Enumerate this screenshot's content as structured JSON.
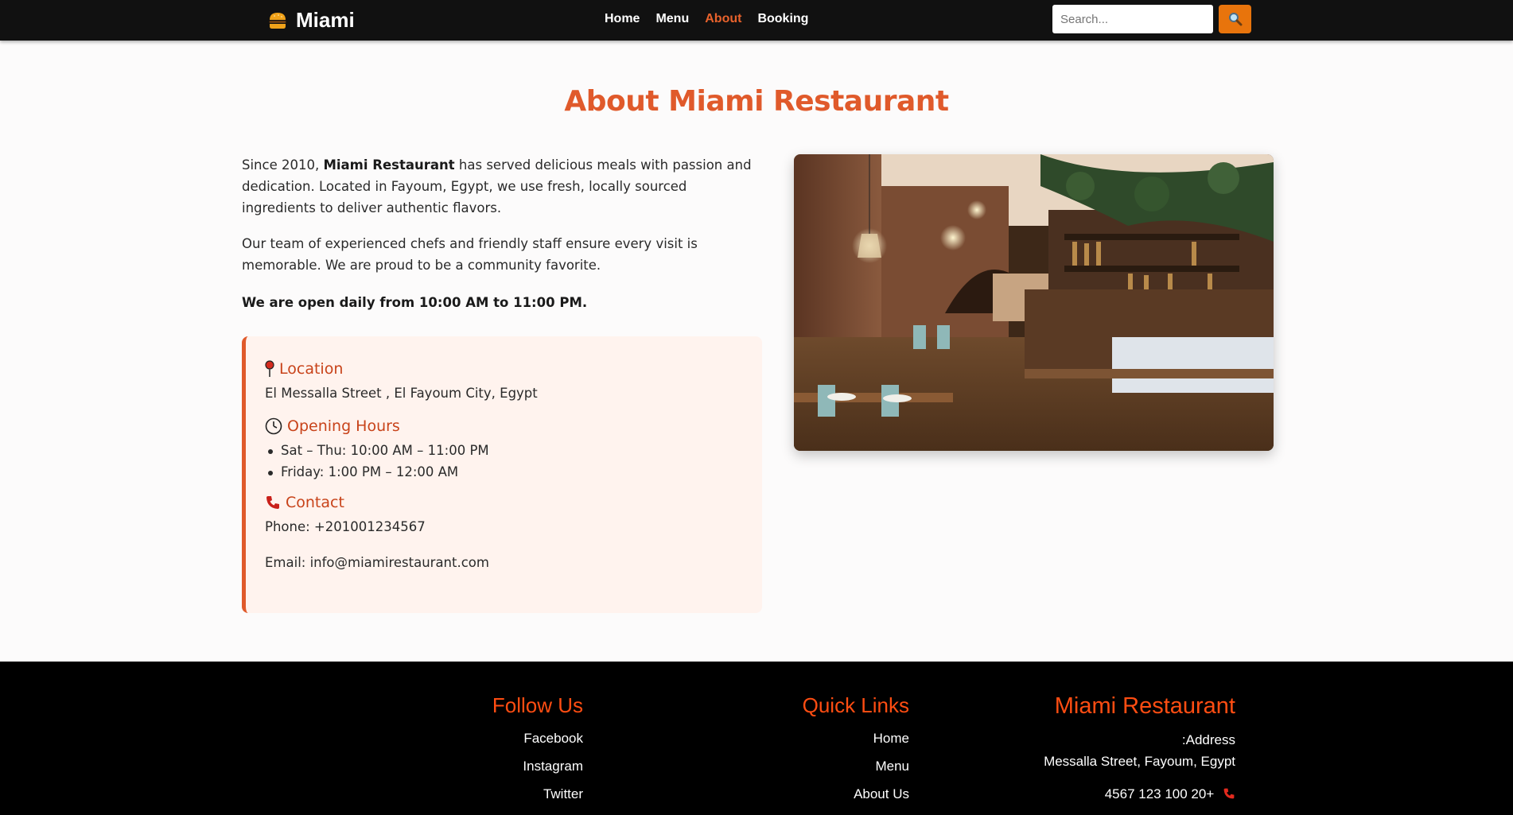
{
  "nav": {
    "brand": "Miami",
    "links": [
      "Home",
      "Menu",
      "About",
      "Booking"
    ],
    "active": "About",
    "search_placeholder": "Search..."
  },
  "about": {
    "title": "About Miami Restaurant",
    "p1_before": "Since 2010, ",
    "p1_bold": "Miami Restaurant",
    "p1_after": " has served delicious meals with passion and dedication. Located in Fayoum, Egypt, we use fresh, locally sourced ingredients to deliver authentic flavors.",
    "p2": "Our team of experienced chefs and friendly staff ensure every visit is memorable. We are proud to be a community favorite.",
    "p3": "We are open daily from 10:00 AM to 11:00 PM."
  },
  "info": {
    "location_heading": "Location",
    "location_text": "El Messalla Street , El Fayoum City, Egypt",
    "hours_heading": "Opening Hours",
    "hours": [
      "Sat – Thu: 10:00 AM – 11:00 PM",
      "Friday: 1:00 PM – 12:00 AM"
    ],
    "contact_heading": "Contact",
    "phone": "Phone: +201001234567",
    "email": "Email: info@miamirestaurant.com"
  },
  "footer": {
    "follow_heading": "Follow Us",
    "follow_links": [
      "Facebook",
      "Instagram",
      "Twitter"
    ],
    "quick_heading": "Quick Links",
    "quick_links": [
      "Home",
      "Menu",
      "About Us"
    ],
    "restaurant_heading": "Miami Restaurant",
    "address_label": ":Address",
    "address": "Messalla Street, Fayoum, Egypt",
    "phone": "4567 123 100 20+"
  },
  "colors": {
    "accent": "#e05a2b",
    "footer_accent": "#ff4d12",
    "nav_bg": "#111111"
  }
}
